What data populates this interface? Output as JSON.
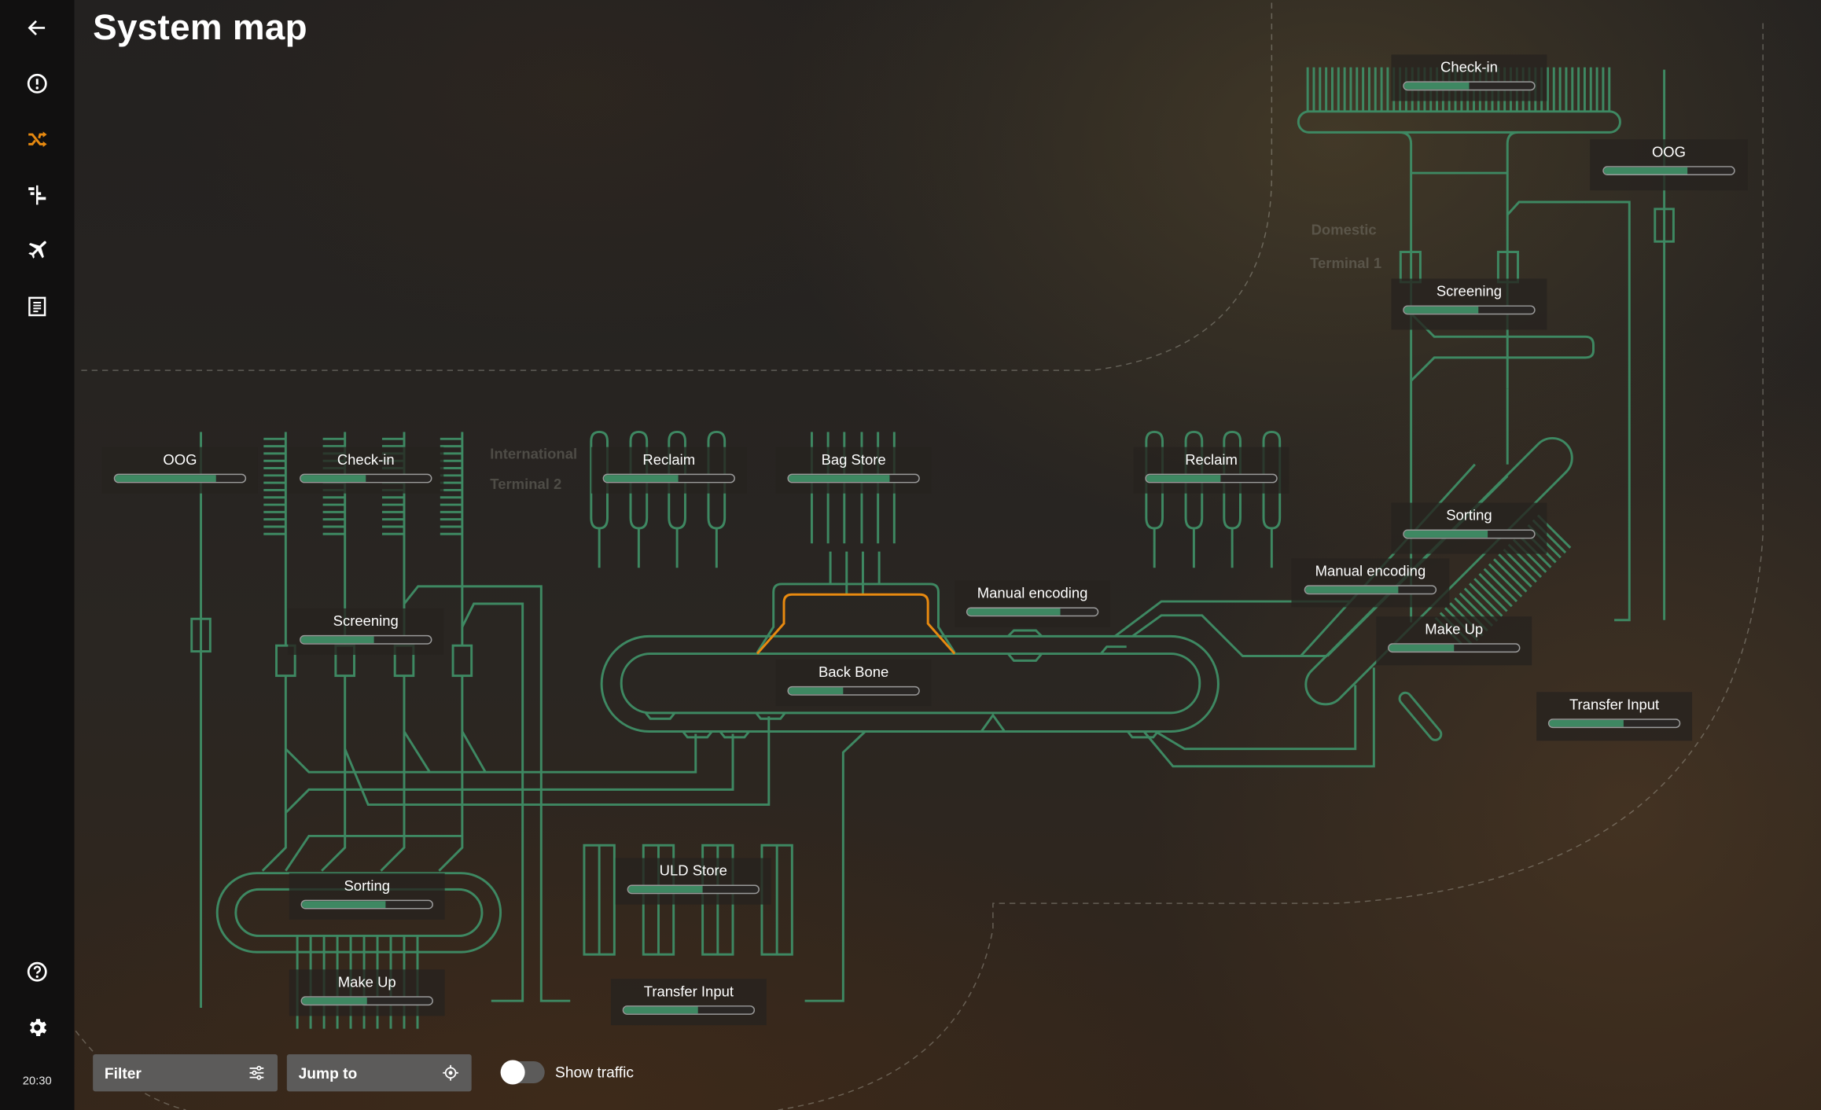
{
  "page": {
    "title": "System map",
    "clock": "20:30"
  },
  "sidebar": {
    "items": [
      {
        "icon": "back-arrow-icon",
        "label": "Back"
      },
      {
        "icon": "alert-icon",
        "label": "Alerts"
      },
      {
        "icon": "shuffle-icon",
        "label": "System map",
        "active": true
      },
      {
        "icon": "gantt-icon",
        "label": "Schedule"
      },
      {
        "icon": "airplane-icon",
        "label": "Flights"
      },
      {
        "icon": "document-icon",
        "label": "Reports"
      }
    ],
    "bottom_items": [
      {
        "icon": "help-icon",
        "label": "Help"
      },
      {
        "icon": "settings-gear-icon",
        "label": "Settings"
      }
    ],
    "active_color": "#e88a10"
  },
  "zones": {
    "t2_line1": "International",
    "t2_line2": "Terminal 2",
    "t1_line1": "Domestic",
    "t1_line2": "Terminal 1"
  },
  "colors": {
    "conveyor": "#3e8862",
    "highlight": "#e88a10",
    "bar_fill": "#3e8862",
    "bar_track": "#2a2725"
  },
  "nodes": {
    "t2_oog": {
      "label": "OOG",
      "load": 0.78
    },
    "t2_checkin": {
      "label": "Check-in",
      "load": 0.5
    },
    "t2_screening": {
      "label": "Screening",
      "load": 0.56
    },
    "t2_sorting": {
      "label": "Sorting",
      "load": 0.64
    },
    "t2_makeup": {
      "label": "Make Up",
      "load": 0.5
    },
    "reclaim_a": {
      "label": "Reclaim",
      "load": 0.57
    },
    "bag_store": {
      "label": "Bag Store",
      "load": 0.78
    },
    "back_bone": {
      "label": "Back Bone",
      "load": 0.42
    },
    "manual_enc_a": {
      "label": "Manual encoding",
      "load": 0.71
    },
    "uld_store": {
      "label": "ULD Store",
      "load": 0.57
    },
    "transfer_a": {
      "label": "Transfer Input",
      "load": 0.57
    },
    "reclaim_b": {
      "label": "Reclaim",
      "load": 0.57
    },
    "t1_checkin": {
      "label": "Check-in",
      "load": 0.5
    },
    "t1_oog": {
      "label": "OOG",
      "load": 0.64
    },
    "t1_screening": {
      "label": "Screening",
      "load": 0.57
    },
    "t1_sorting": {
      "label": "Sorting",
      "load": 0.64
    },
    "manual_enc_b": {
      "label": "Manual encoding",
      "load": 0.71
    },
    "t1_makeup": {
      "label": "Make Up",
      "load": 0.5
    },
    "transfer_b": {
      "label": "Transfer Input",
      "load": 0.57
    }
  },
  "bottom_bar": {
    "filter_label": "Filter",
    "jump_label": "Jump to",
    "traffic_label": "Show traffic",
    "traffic_on": false
  }
}
